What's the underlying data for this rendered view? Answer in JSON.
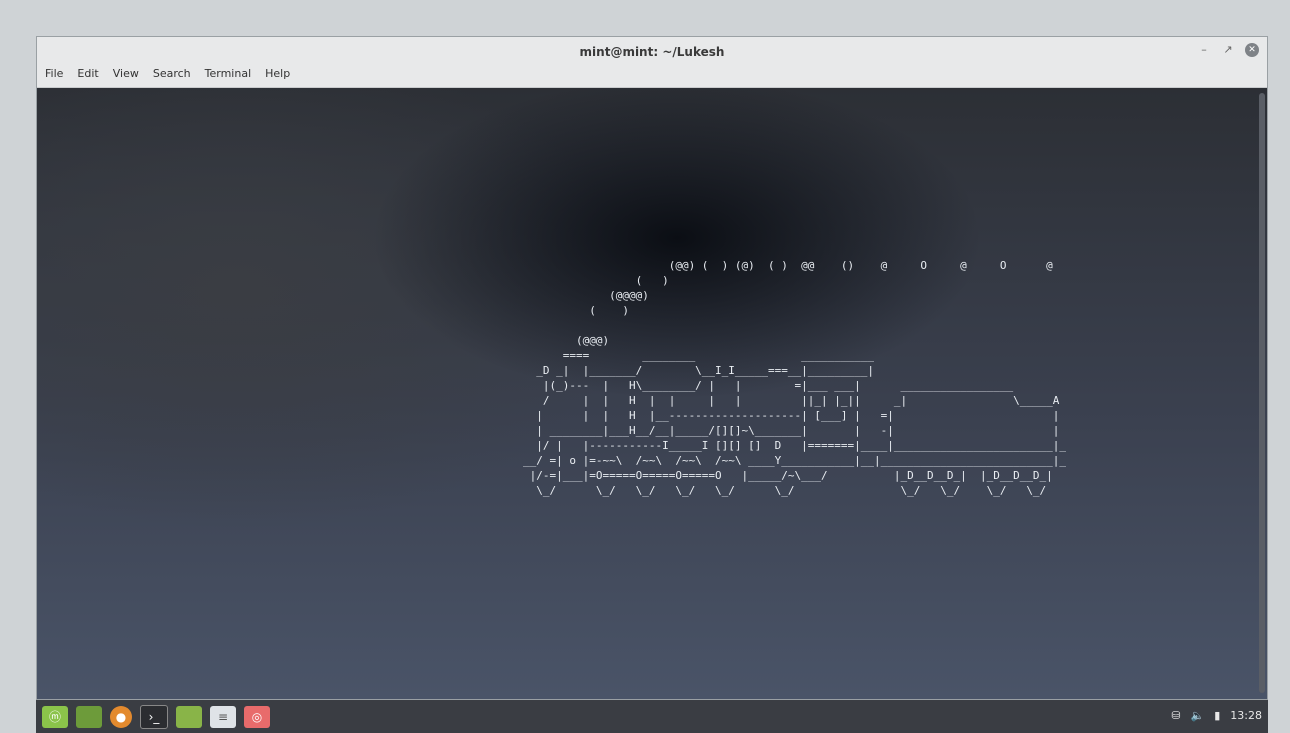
{
  "window": {
    "title": "mint@mint: ~/Lukesh",
    "menu": [
      "File",
      "Edit",
      "View",
      "Search",
      "Terminal",
      "Help"
    ],
    "controls": {
      "minimize": "–",
      "maximize": "↗",
      "close": "✕"
    }
  },
  "terminal": {
    "ascii_art": "                      (@@) (  ) (@)  ( )  @@    ()    @     O     @     O      @\n                 (   )\n             (@@@@)\n          (    )\n\n        (@@@)\n      ====        ________                ___________\n  _D _|  |_______/        \\__I_I_____===__|_________|\n   |(_)---  |   H\\________/ |   |        =|___ ___|      _________________\n   /     |  |   H  |  |     |   |         ||_| |_||     _|                \\_____A\n  |      |  |   H  |__--------------------| [___] |   =|                        |\n  | ________|___H__/__|_____/[][]~\\_______|       |   -|                        |\n  |/ |   |-----------I_____I [][] []  D   |=======|____|________________________|_\n__/ =| o |=-~~\\  /~~\\  /~~\\  /~~\\ ____Y___________|__|__________________________|_\n |/-=|___|=O=====O=====O=====O   |_____/~\\___/          |_D__D__D_|  |_D__D__D_|\n  \\_/      \\_/   \\_/   \\_/   \\_/      \\_/                \\_/   \\_/    \\_/   \\_/"
  },
  "taskbar": {
    "items": [
      "menu",
      "show-desktop",
      "firefox",
      "terminal",
      "files",
      "text-editor",
      "extra-app"
    ],
    "tray": {
      "clock": "13:28"
    }
  }
}
